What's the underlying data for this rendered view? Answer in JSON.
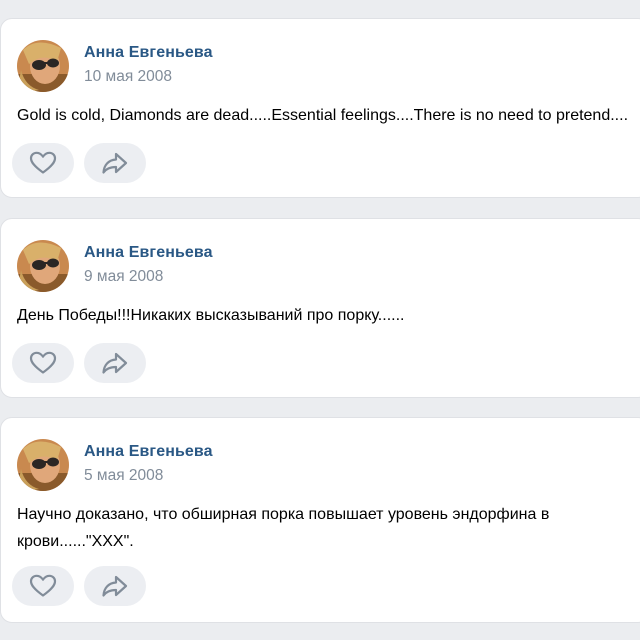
{
  "colors": {
    "background": "#ebedf0",
    "card": "#ffffff",
    "author": "#2a5885",
    "date": "#818c99",
    "text": "#000000",
    "action_pill": "#eceef2",
    "icon": "#818c99"
  },
  "icons": {
    "like": "heart-icon",
    "share": "share-arrow-icon"
  },
  "posts": [
    {
      "author": "Анна Евгеньева",
      "date": "10 мая 2008",
      "text": "Gold is cold, Diamonds are dead.....Essential feelings....There is no need to pretend...."
    },
    {
      "author": "Анна Евгеньева",
      "date": "9 мая 2008",
      "text": "День Победы!!!Никаких высказываний про порку......"
    },
    {
      "author": "Анна Евгеньева",
      "date": "5 мая 2008",
      "text": "Научно доказано, что обширная порка повышает уровень эндорфина в крови......\"XXX\"."
    }
  ]
}
